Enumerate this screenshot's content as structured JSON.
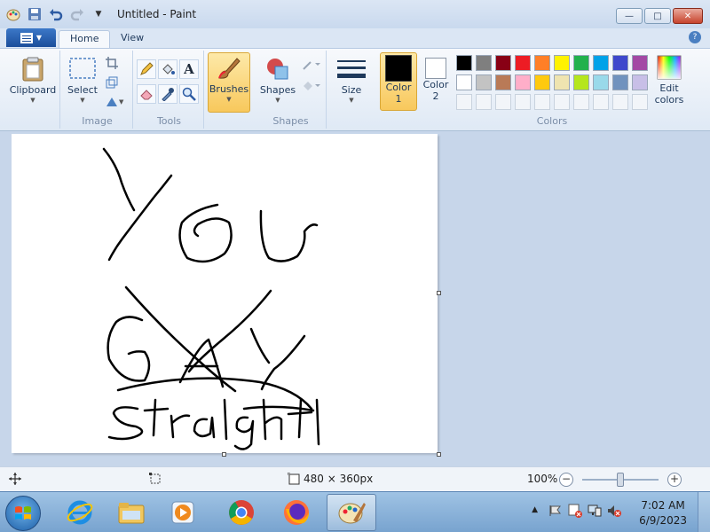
{
  "window": {
    "title": "Untitled - Paint"
  },
  "tabs": {
    "home": "Home",
    "view": "View"
  },
  "ribbon": {
    "clipboard": "Clipboard",
    "select": "Select",
    "image_group": "Image",
    "tools_group": "Tools",
    "brushes": "Brushes",
    "shapes": "Shapes",
    "shapes_group": "Shapes",
    "size": "Size",
    "color1_line1": "Color",
    "color1_line2": "1",
    "color2_line1": "Color",
    "color2_line2": "2",
    "colors_group": "Colors",
    "edit_colors_line1": "Edit",
    "edit_colors_line2": "colors"
  },
  "colors": {
    "color1": "#000000",
    "color2": "#ffffff",
    "row1": [
      "#000000",
      "#7f7f7f",
      "#880015",
      "#ed1c24",
      "#ff7f27",
      "#fff200",
      "#22b14c",
      "#00a2e8",
      "#3f48cc",
      "#a349a4"
    ],
    "row2": [
      "#ffffff",
      "#c3c3c3",
      "#b97a57",
      "#ffaec9",
      "#ffc90e",
      "#efe4b0",
      "#b5e61d",
      "#99d9ea",
      "#7092be",
      "#c8bfe7"
    ]
  },
  "status": {
    "image_size": "480 × 360px",
    "zoom": "100%"
  },
  "clock": {
    "time": "7:02 AM",
    "date": "6/9/2023"
  }
}
